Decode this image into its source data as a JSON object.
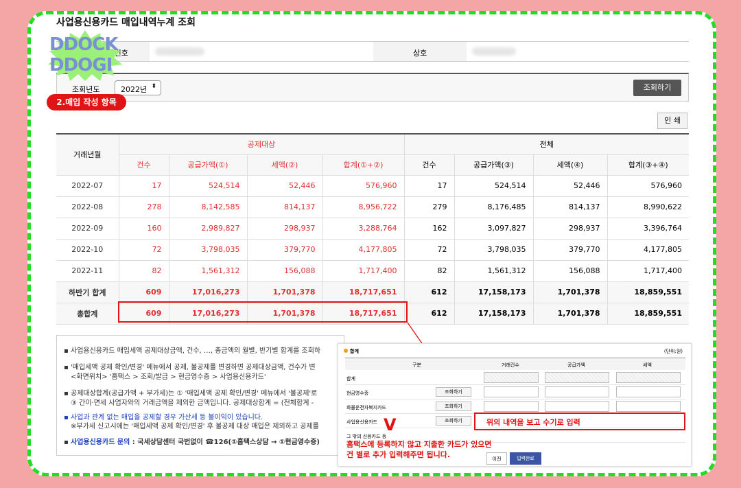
{
  "page": {
    "title": "사업용신용카드 매입내역누계 조회"
  },
  "info": {
    "reg_no_label": "사업자등록번호",
    "company_label": "상호"
  },
  "logo": {
    "line1": "DDOCK",
    "line2": "DDOGI"
  },
  "search": {
    "year_label": "조회년도",
    "year_value": "2022년",
    "search_button": "조회하기"
  },
  "badge": {
    "text": "2.매입 작성 항목"
  },
  "print_button": "인 쇄",
  "table": {
    "col_month": "거래년월",
    "group_deduct": "공제대상",
    "group_total": "전체",
    "sub_headers": [
      "건수",
      "공급가액(①)",
      "세액(②)",
      "합계(①+②)",
      "건수",
      "공급가액(③)",
      "세액(④)",
      "합계(③+④)"
    ],
    "rows": [
      {
        "month": "2022-07",
        "c1": "17",
        "c2": "524,514",
        "c3": "52,446",
        "c4": "576,960",
        "c5": "17",
        "c6": "524,514",
        "c7": "52,446",
        "c8": "576,960"
      },
      {
        "month": "2022-08",
        "c1": "278",
        "c2": "8,142,585",
        "c3": "814,137",
        "c4": "8,956,722",
        "c5": "279",
        "c6": "8,176,485",
        "c7": "814,137",
        "c8": "8,990,622"
      },
      {
        "month": "2022-09",
        "c1": "160",
        "c2": "2,989,827",
        "c3": "298,937",
        "c4": "3,288,764",
        "c5": "162",
        "c6": "3,097,827",
        "c7": "298,937",
        "c8": "3,396,764"
      },
      {
        "month": "2022-10",
        "c1": "72",
        "c2": "3,798,035",
        "c3": "379,770",
        "c4": "4,177,805",
        "c5": "72",
        "c6": "3,798,035",
        "c7": "379,770",
        "c8": "4,177,805"
      },
      {
        "month": "2022-11",
        "c1": "82",
        "c2": "1,561,312",
        "c3": "156,088",
        "c4": "1,717,400",
        "c5": "82",
        "c6": "1,561,312",
        "c7": "156,088",
        "c8": "1,717,400"
      },
      {
        "month": "하반기 합계",
        "c1": "609",
        "c2": "17,016,273",
        "c3": "1,701,378",
        "c4": "18,717,651",
        "c5": "612",
        "c6": "17,158,173",
        "c7": "1,701,378",
        "c8": "18,859,551"
      },
      {
        "month": "총합계",
        "c1": "609",
        "c2": "17,016,273",
        "c3": "1,701,378",
        "c4": "18,717,651",
        "c5": "612",
        "c6": "17,158,173",
        "c7": "1,701,378",
        "c8": "18,859,551"
      }
    ]
  },
  "notes": {
    "n1": "사업용신용카드 매입세액 공제대상금액, 건수, …, 총금액의 월별, 반기별 합계를 조회하",
    "n2a": "'매입세액 공제 확인/변경' 메뉴에서 공제, 불공제를 변경하면 공제대상금액, 건수가 변",
    "n2b": "<화면위치> '홈택스 > 조회/발급 > 현금영수증 > 사업용신용카드'",
    "n3a": "공제대상합계(공급가액 + 부가세)는 ① '매입세액 공제 확인/변경' 메뉴에서 '불공제'로",
    "n3b": "③ 간이·면세 사업자와의 거래금액을 제외한 금액입니다. 공제대상합계 = (전체합계 -",
    "n4a": "사업과 관계 없는 매입을 공제할 경우 가산세 등 불이익이 있습니다.",
    "n4b": "※부가세 신고시에는 '매입세액 공제 확인/변경' 후 불공제 대상 매입은 제외하고 공제를",
    "n5_label": "사업용신용카드 문의",
    "n5_text": " : 국세상담센터 국번없이 ☎126(①홈택스상담 → ①현금영수증)"
  },
  "popup": {
    "title": "합계",
    "unit": "(단위:원)",
    "headers": [
      "구분",
      "거래건수",
      "공급가액",
      "세액"
    ],
    "rows": [
      "합계",
      "현금영수증",
      "화물운전자복지카드",
      "사업용신용카드",
      "그 밖의 신용카드 등"
    ],
    "lookup_button": "조회하기",
    "highlight_text": "위의 내역을 보고 수기로 입력",
    "v_mark": "V",
    "note_line1": "홈택스에 등록하지 않고 지출한 카드가 있으면",
    "note_line2": "건 별로 추가 입력해주면 됩니다.",
    "prev_button": "이전",
    "done_button": "입력완료"
  }
}
